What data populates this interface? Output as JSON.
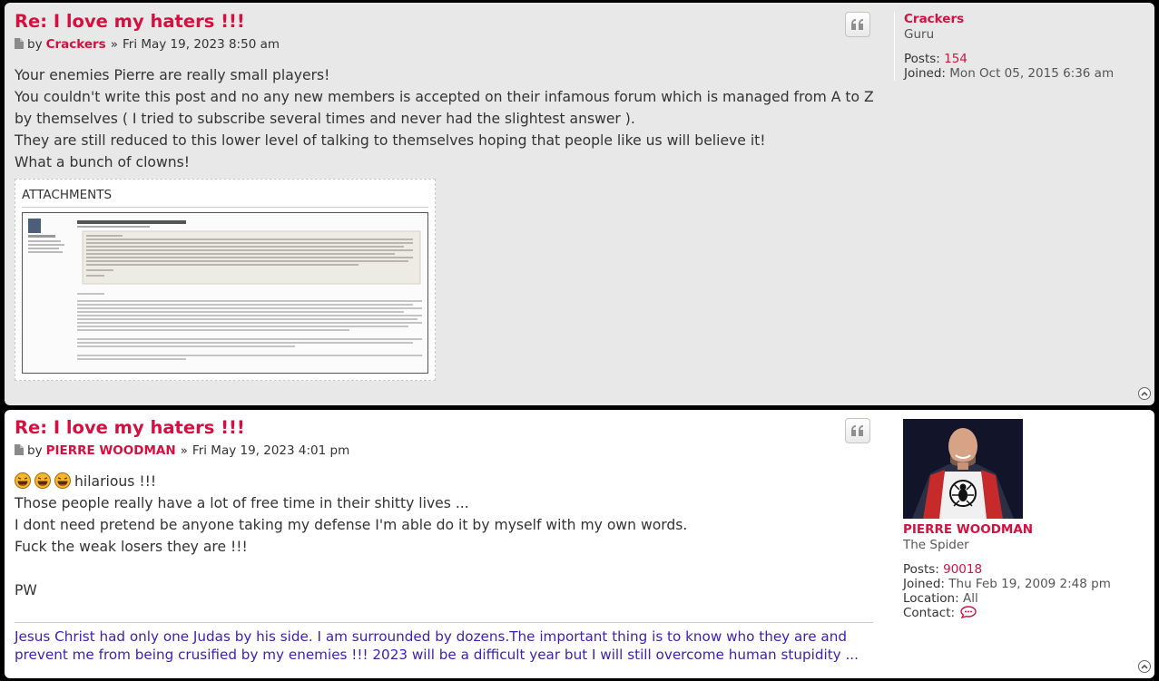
{
  "posts": [
    {
      "title": "Re: I love my haters !!!",
      "by": "by",
      "author": "Crackers",
      "sep": "»",
      "date": "Fri May 19, 2023 8:50 am",
      "lines": [
        "Your enemies Pierre are really small players!",
        "You couldn't write this post and no any new members is accepted on their infamous forum which is managed from A to Z by themselves ( I tried to subscribe several times and never had the slightest answer ).",
        "They are still reduced to this lower level of talking to themselves hoping that people like us will believe it!",
        "What a bunch of clowns!"
      ],
      "attachments_label": "ATTACHMENTS",
      "profile": {
        "username": "Crackers",
        "rank": "Guru",
        "posts_label": "Posts:",
        "posts": "154",
        "joined_label": "Joined:",
        "joined": "Mon Oct 05, 2015 6:36 am"
      }
    },
    {
      "title": "Re: I love my haters !!!",
      "by": "by",
      "author": "PIERRE WOODMAN",
      "sep": "»",
      "date": "Fri May 19, 2023 4:01 pm",
      "first_line_text": "hilarious !!!",
      "lines": [
        "Those people really have a lot of free time in their shitty lives ...",
        "I dont need pretend be anyone taking my defense I'm able do it by myself with my own words.",
        "Fuck the weak losers they are !!!",
        "",
        "PW"
      ],
      "signature": "Jesus Christ had only one Judas by his side. I am surrounded by dozens.The important thing is to know who they are and prevent me from being crusified by my enemies !!! 2023 will be a difficult year but I will still overcome human stupidity ...",
      "profile": {
        "username": "PIERRE WOODMAN",
        "rank": "The Spider",
        "posts_label": "Posts:",
        "posts": "90018",
        "joined_label": "Joined:",
        "joined": "Thu Feb 19, 2009 2:48 pm",
        "location_label": "Location:",
        "location": "All",
        "contact_label": "Contact:"
      }
    }
  ],
  "colors": {
    "accent": "#d31141",
    "signature": "#3c1fb2",
    "post_bg_alt": "#e8e8e8"
  }
}
